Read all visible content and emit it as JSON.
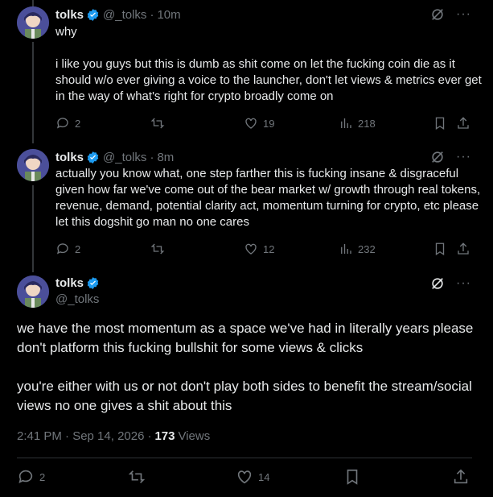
{
  "tweets": [
    {
      "name": "tolks",
      "handle": "@_tolks",
      "dot": "·",
      "time": "10m",
      "text": "why\n\ni like you guys but this is dumb as shit come on let the fucking coin die as it should w/o ever giving a voice to the launcher, don't let views & metrics ever get in the way of what's right for crypto broadly come on",
      "replies": "2",
      "likes": "19",
      "views": "218"
    },
    {
      "name": "tolks",
      "handle": "@_tolks",
      "dot": "·",
      "time": "8m",
      "text": "actually you know what, one step farther this is fucking insane & disgraceful given how far we've come out of the bear market w/ growth through real tokens, revenue, demand, potential clarity act, momentum turning for crypto, etc please let this dogshit go man no one cares",
      "replies": "2",
      "likes": "12",
      "views": "232"
    }
  ],
  "main": {
    "name": "tolks",
    "handle": "@_tolks",
    "text": "we have the most momentum as a space we've had in literally years please don't platform this fucking bullshit for some views & clicks\n\nyou're either with us or not don't play both sides to benefit the stream/social views no one gives a shit about this",
    "timestamp": "2:41 PM · Sep 14, 2026",
    "dot": "·",
    "view_count": "173",
    "views_label": "Views",
    "replies": "2",
    "likes": "14"
  },
  "more_label": "···",
  "colors": {
    "background": "#000000",
    "text": "#e7e9ea",
    "muted": "#71767b",
    "verified": "#1d9bf0",
    "divider": "#2f3336"
  }
}
